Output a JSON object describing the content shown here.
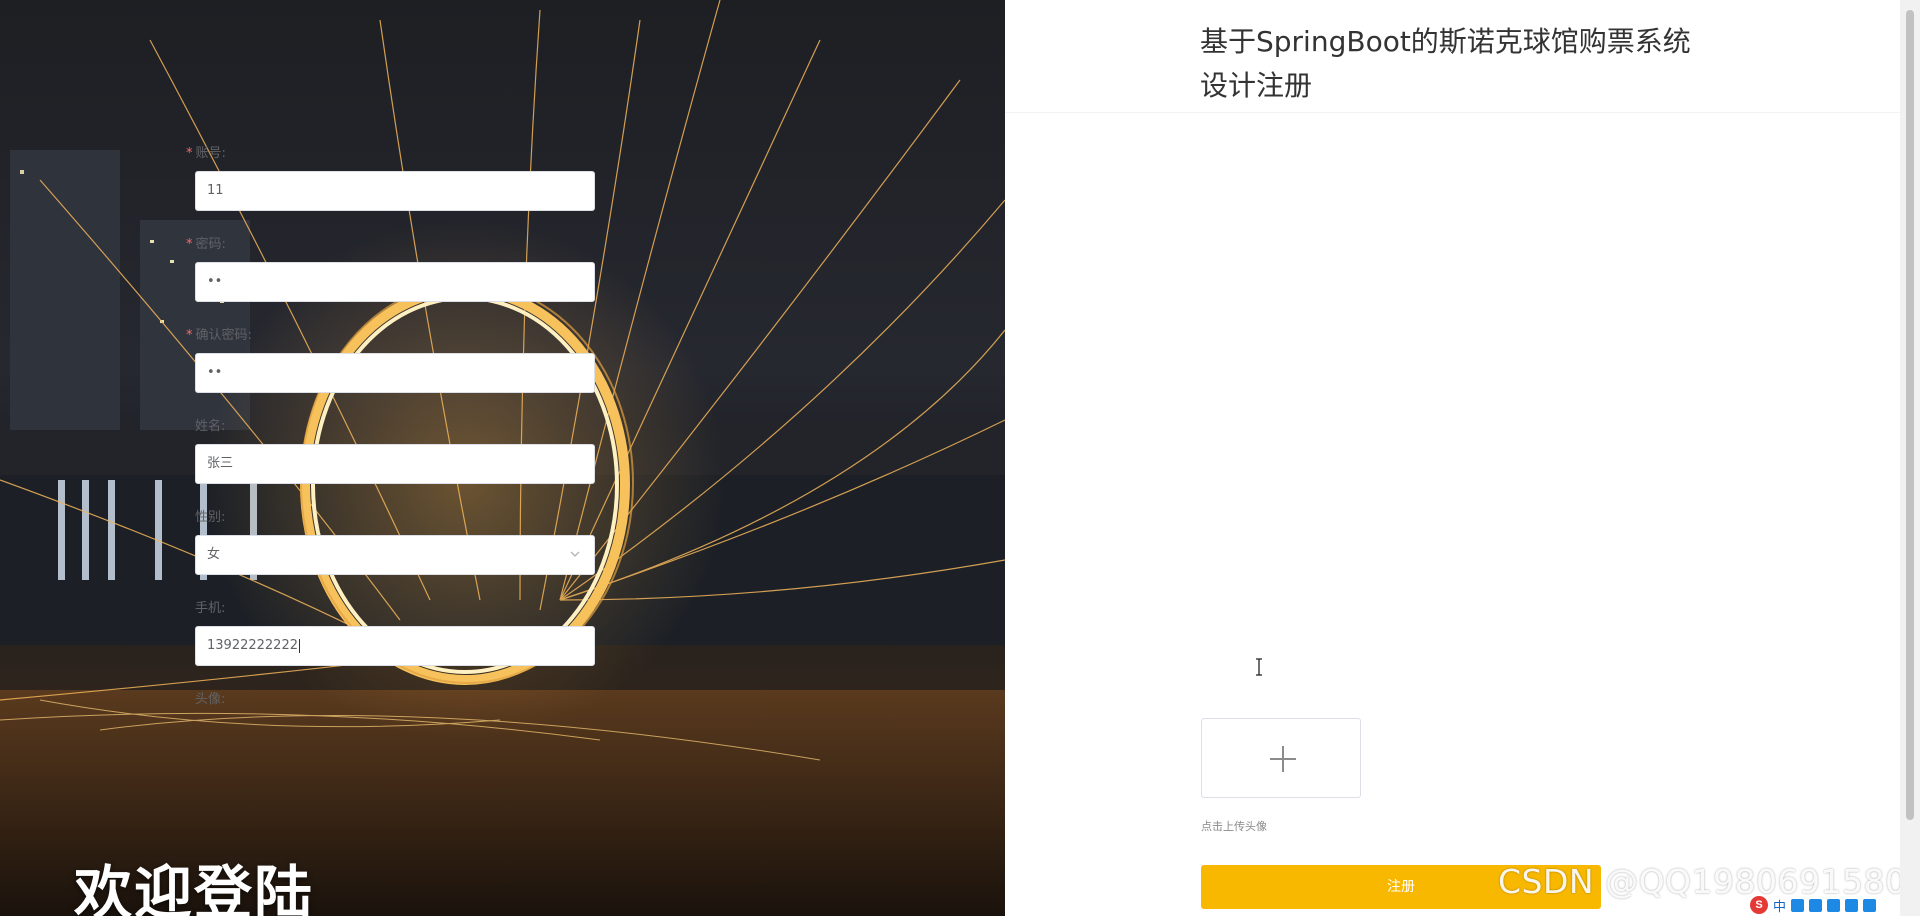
{
  "left_panel": {
    "welcome_text": "欢迎登陆"
  },
  "page": {
    "title": "基于SpringBoot的斯诺克球馆购票系统设计注册"
  },
  "form": {
    "account": {
      "label": "账号:",
      "required_mark": "*",
      "value": "11"
    },
    "password": {
      "label": "密码:",
      "required_mark": "*",
      "value": "••"
    },
    "confirm_password": {
      "label": "确认密码:",
      "required_mark": "*",
      "value": "••"
    },
    "name": {
      "label": "姓名:",
      "value": "张三"
    },
    "gender": {
      "label": "性别:",
      "value": "女",
      "icon": "chevron-down-icon"
    },
    "phone": {
      "label": "手机:",
      "value": "13922222222"
    },
    "avatar": {
      "label": "头像:",
      "hint": "点击上传头像",
      "icon": "plus-icon"
    },
    "submit_label": "注册"
  },
  "watermark": "CSDN @QQ1980691580",
  "ime_tray": {
    "logo": "S",
    "mode": "中",
    "icons": [
      "punctuation-icon",
      "microphone-icon",
      "keyboard-icon",
      "skin-icon",
      "toolbox-icon"
    ]
  },
  "colors": {
    "accent": "#f9b800",
    "required": "#f56c6c",
    "border": "#dcdfe6"
  }
}
